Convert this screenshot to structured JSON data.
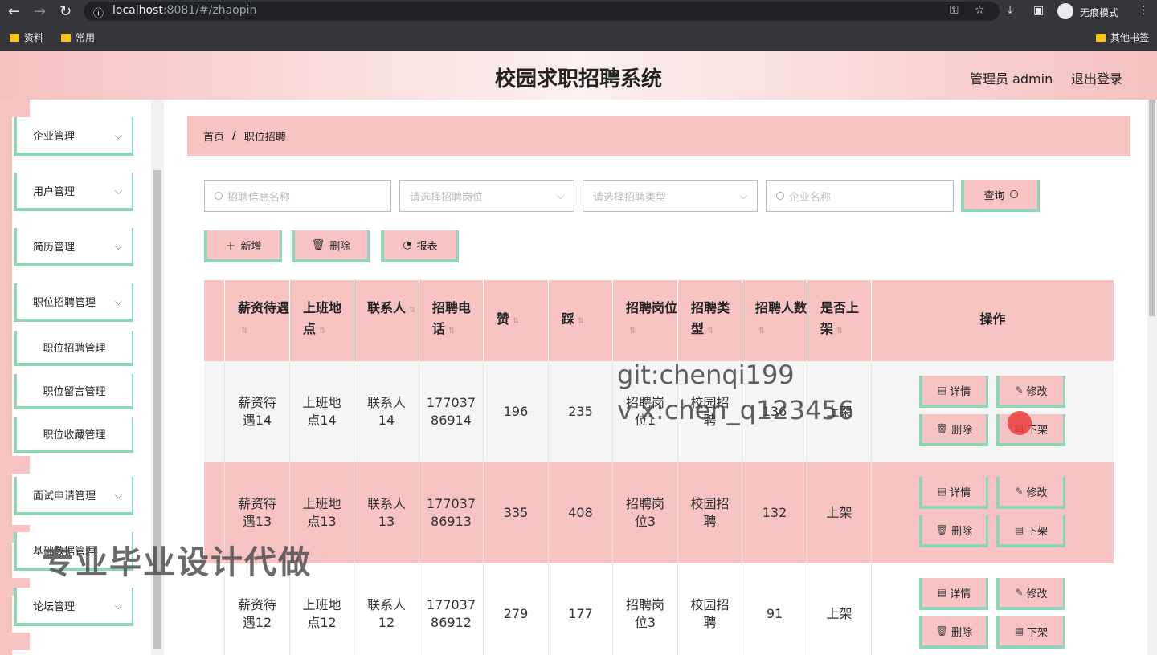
{
  "browser": {
    "url_host": "localhost",
    "url_rest": ":8081/#/zhaopin",
    "incognito_label": "无痕模式",
    "bookmarks": [
      "资料",
      "常用"
    ],
    "other_bookmarks": "其他书签"
  },
  "header": {
    "title": "校园求职招聘系统",
    "admin_label": "管理员 admin",
    "logout_label": "退出登录"
  },
  "sidebar": {
    "items": [
      {
        "label": "企业管理"
      },
      {
        "label": "用户管理"
      },
      {
        "label": "简历管理"
      },
      {
        "label": "职位招聘管理"
      },
      {
        "label": "面试申请管理"
      },
      {
        "label": "基础数据管理"
      },
      {
        "label": "论坛管理"
      }
    ],
    "sub_items": [
      {
        "label": "职位招聘管理"
      },
      {
        "label": "职位留言管理"
      },
      {
        "label": "职位收藏管理"
      }
    ]
  },
  "breadcrumb": {
    "home": "首页",
    "separator": "/",
    "current": "职位招聘"
  },
  "search": {
    "name_placeholder": "招聘信息名称",
    "position_placeholder": "请选择招聘岗位",
    "type_placeholder": "请选择招聘类型",
    "company_placeholder": "企业名称",
    "query_label": "查询"
  },
  "toolbar": {
    "add_label": "新增",
    "delete_label": "删除",
    "report_label": "报表"
  },
  "table": {
    "columns": [
      "薪资待遇",
      "上班地点",
      "联系人",
      "招聘电话",
      "赞",
      "踩",
      "招聘岗位",
      "招聘类型",
      "招聘人数",
      "是否上架",
      "操作"
    ],
    "rows": [
      {
        "salary": "薪资待遇14",
        "location": "上班地点14",
        "contact": "联系人14",
        "phone": "17703786914",
        "likes": "196",
        "dislikes": "235",
        "position": "招聘岗位1",
        "type": "校园招聘",
        "count": "136",
        "status": "上架"
      },
      {
        "salary": "薪资待遇13",
        "location": "上班地点13",
        "contact": "联系人13",
        "phone": "17703786913",
        "likes": "335",
        "dislikes": "408",
        "position": "招聘岗位3",
        "type": "校园招聘",
        "count": "132",
        "status": "上架"
      },
      {
        "salary": "薪资待遇12",
        "location": "上班地点12",
        "contact": "联系人12",
        "phone": "17703786912",
        "likes": "279",
        "dislikes": "177",
        "position": "招聘岗位3",
        "type": "校园招聘",
        "count": "91",
        "status": "上架"
      }
    ],
    "actions": {
      "detail": "详情",
      "edit": "修改",
      "delete": "删除",
      "unlist": "下架"
    }
  },
  "overlays": {
    "watermark_line1": "git:chenqi199",
    "watermark_line2": "v x:chen_q123456",
    "promo": "专业毕业设计代做"
  },
  "colors": {
    "pink": "#f7c3c3",
    "mint": "#8fd6b6"
  }
}
